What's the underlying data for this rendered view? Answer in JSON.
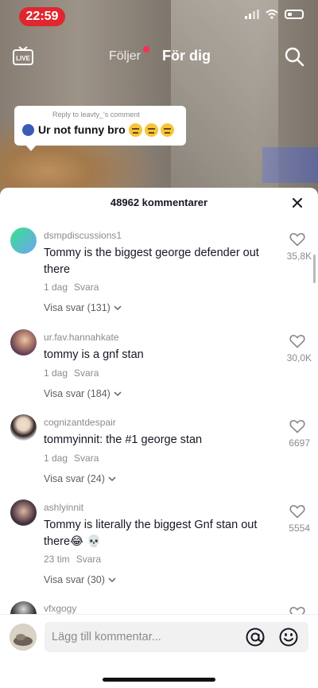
{
  "status_bar": {
    "time": "22:59"
  },
  "nav": {
    "tab_following": "Följer",
    "tab_for_you": "För dig"
  },
  "reply_bubble": {
    "caption": "Reply to leavty_'s comment",
    "text": "Ur not funny bro"
  },
  "comments_sheet": {
    "title": "48962 kommentarer",
    "reply_label": "Svara",
    "comments": [
      {
        "username": "dsmpdiscussions1",
        "text": "Tommy is the biggest george defender out there",
        "age": "1 dag",
        "replies": "Visa svar (131)",
        "likes": "35,8K"
      },
      {
        "username": "ur.fav.hannahkate",
        "text": "tommy is a gnf stan",
        "age": "1 dag",
        "replies": "Visa svar (184)",
        "likes": "30,0K"
      },
      {
        "username": "cognizantdespair",
        "text": "tommyinnit: the #1 george stan",
        "age": "1 dag",
        "replies": "Visa svar (24)",
        "likes": "6697"
      },
      {
        "username": "ashlyinnit",
        "text": "Tommy is literally the biggest Gnf stan out there😂 💀",
        "age": "23 tim",
        "replies": "Visa svar (30)",
        "likes": "5554"
      },
      {
        "username": "vfxgogy"
      }
    ],
    "input_placeholder": "Lägg till kommentar..."
  },
  "colors": {
    "accent_red": "#fe2c55",
    "time_pill": "#e0262e",
    "text_primary": "#161823",
    "text_secondary": "#8a8b91"
  },
  "icons": [
    "live-icon",
    "search-icon",
    "close-icon",
    "heart-icon",
    "chevron-down-icon",
    "at-icon",
    "emoji-icon"
  ]
}
